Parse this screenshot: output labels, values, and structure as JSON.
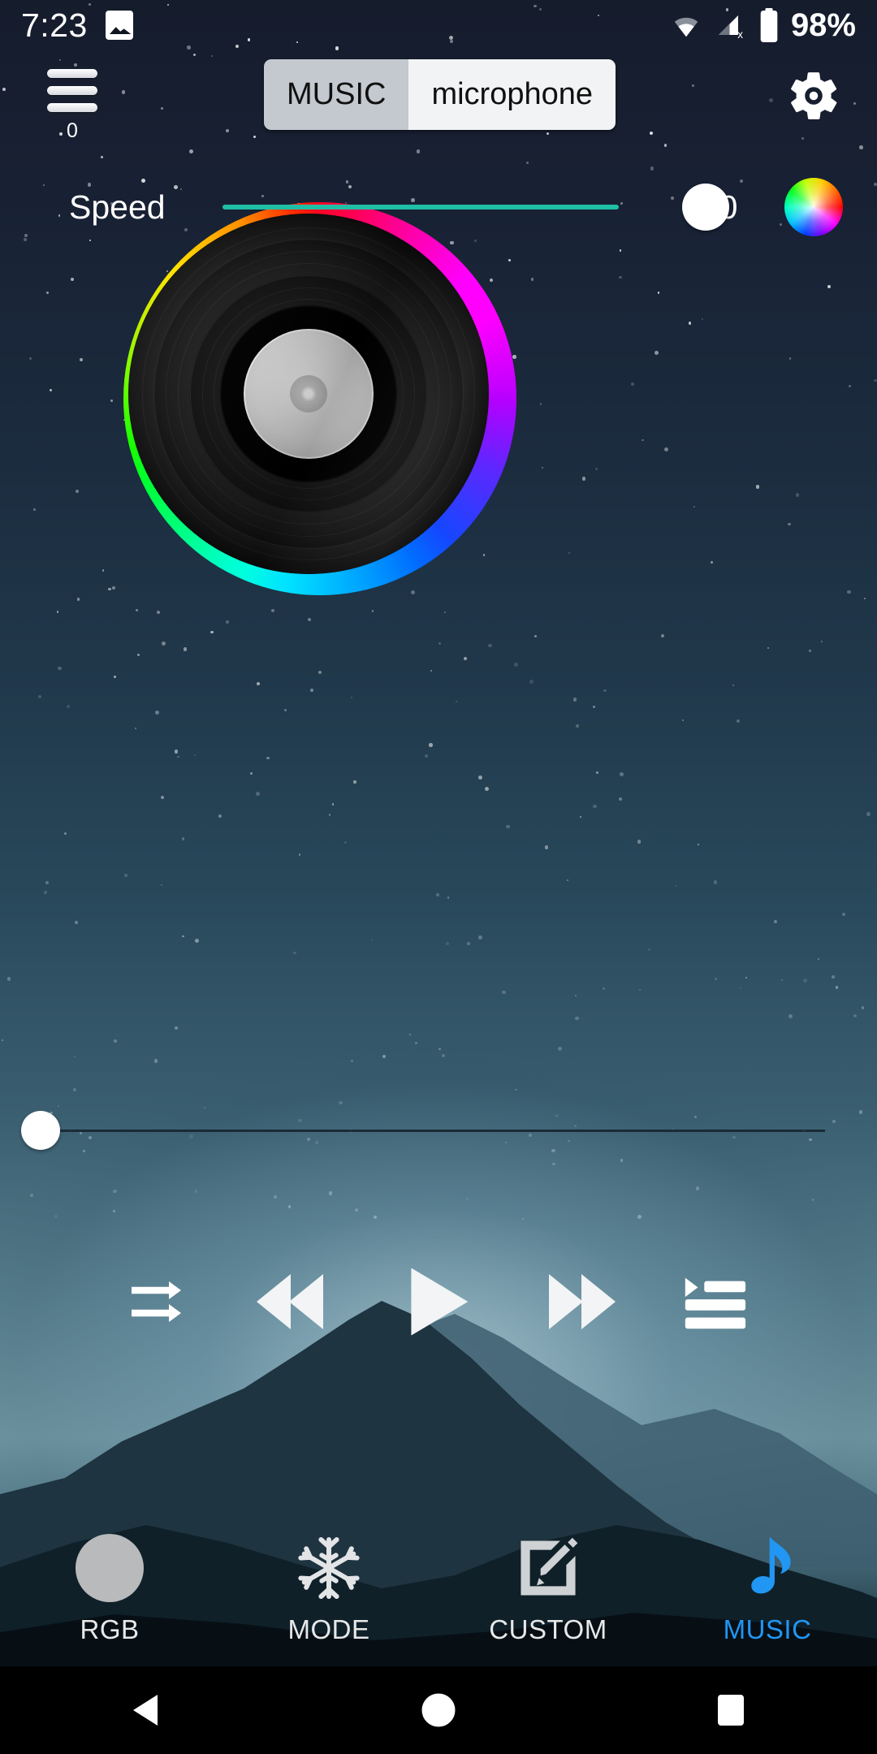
{
  "status_bar": {
    "time": "7:23",
    "battery_percent": "98%",
    "icons": [
      "image-icon",
      "wifi-icon",
      "signal-off-icon",
      "battery-icon"
    ]
  },
  "header": {
    "menu_icon": "hamburger-icon",
    "menu_count": "0",
    "settings_icon": "gear-icon",
    "segmented": {
      "options": [
        {
          "label": "MUSIC",
          "selected": true
        },
        {
          "label": "microphone",
          "selected": false
        }
      ]
    }
  },
  "speed": {
    "label": "Speed",
    "value": "100",
    "min": 0,
    "max": 100,
    "percent": 100,
    "track_color": "#1fbfa6",
    "color_wheel_icon": "color-wheel-icon"
  },
  "record": {
    "icon": "vinyl-record",
    "ring": "rainbow-ring"
  },
  "progress": {
    "value": 0,
    "percent": 0
  },
  "media_controls": [
    {
      "name": "repeat-button",
      "icon": "repeat-arrows-icon"
    },
    {
      "name": "previous-button",
      "icon": "rewind-icon"
    },
    {
      "name": "play-button",
      "icon": "play-icon"
    },
    {
      "name": "next-button",
      "icon": "fast-forward-icon"
    },
    {
      "name": "playlist-button",
      "icon": "playlist-icon"
    }
  ],
  "bottom_nav": {
    "active_color": "#2196f3",
    "items": [
      {
        "label": "RGB",
        "icon": "color-circle-icon",
        "active": false
      },
      {
        "label": "MODE",
        "icon": "snowflake-icon",
        "active": false
      },
      {
        "label": "CUSTOM",
        "icon": "edit-square-icon",
        "active": false
      },
      {
        "label": "MUSIC",
        "icon": "music-note-icon",
        "active": true
      }
    ]
  },
  "android_nav": {
    "back": "back-triangle-icon",
    "home": "home-circle-icon",
    "recents": "recents-square-icon"
  }
}
